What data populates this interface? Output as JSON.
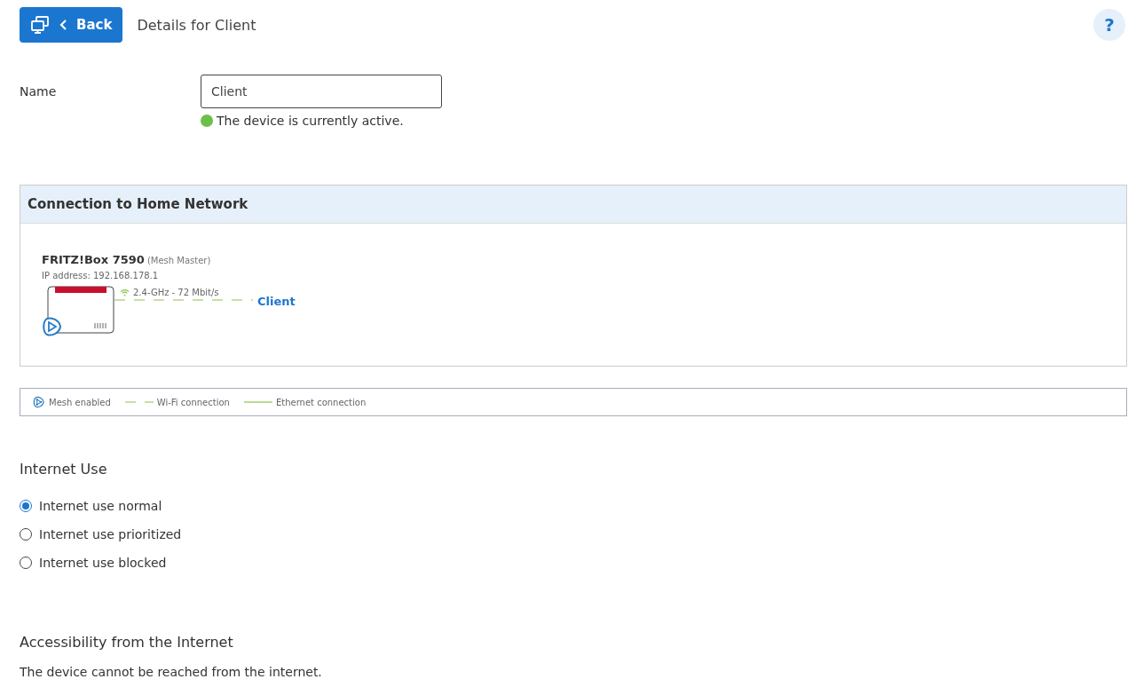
{
  "header": {
    "back_label": "Back",
    "title": "Details for Client",
    "help": "?"
  },
  "name_field": {
    "label": "Name",
    "value": "Client"
  },
  "status": {
    "active": true,
    "text": "The device is currently active."
  },
  "connection": {
    "title": "Connection to Home Network",
    "device": "FRITZ!Box 7590",
    "role": "(Mesh Master)",
    "ip": "IP address: 192.168.178.1",
    "link": {
      "kind": "wifi",
      "text": "2.4-GHz  - 72 Mbit/s"
    },
    "client": "Client"
  },
  "legend": [
    {
      "kind": "mesh",
      "label": "Mesh enabled"
    },
    {
      "kind": "wifi",
      "label": "Wi-Fi connection"
    },
    {
      "kind": "ethernet",
      "label": "Ethernet connection"
    }
  ],
  "internet_use": {
    "title": "Internet Use",
    "options": [
      {
        "label": "Internet use normal",
        "selected": true
      },
      {
        "label": "Internet use prioritized",
        "selected": false
      },
      {
        "label": "Internet use blocked",
        "selected": false
      }
    ]
  },
  "accessibility": {
    "title": "Accessibility from the Internet",
    "text": "The device cannot be reached from the internet."
  }
}
